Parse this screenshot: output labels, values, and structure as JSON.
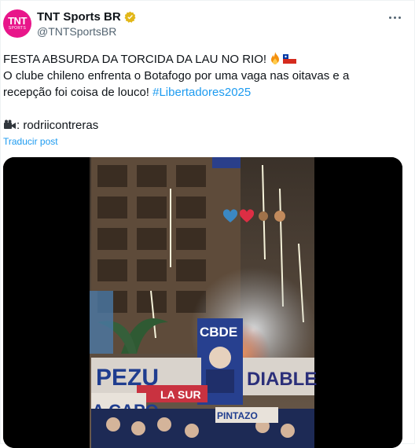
{
  "author": {
    "avatar_top": "TNT",
    "avatar_bottom": "SPORTS",
    "name": "TNT Sports BR",
    "handle": "@TNTSportsBR"
  },
  "post": {
    "line1": "FESTA ABSURDA DA TORCIDA DA LAU NO RIO!",
    "line2": "O clube chileno enfrenta o Botafogo por uma vaga nas oitavas e a",
    "line3_prefix": "recepção foi coisa de louco!",
    "hashtag": "#Libertadores2025",
    "credit": ": rodriicontreras",
    "translate_label": "Traducir post"
  },
  "video": {
    "banner_text_1": "CBDE",
    "banner_text_2": "PEZU",
    "banner_text_3": "DIABLE",
    "banner_text_4": "A CAPO",
    "banner_text_5": "PINTAZO",
    "sign_text": "LA SUR"
  },
  "colors": {
    "brand_pink": "#e8168a",
    "link_blue": "#1d9bf0",
    "muted": "#536471"
  }
}
